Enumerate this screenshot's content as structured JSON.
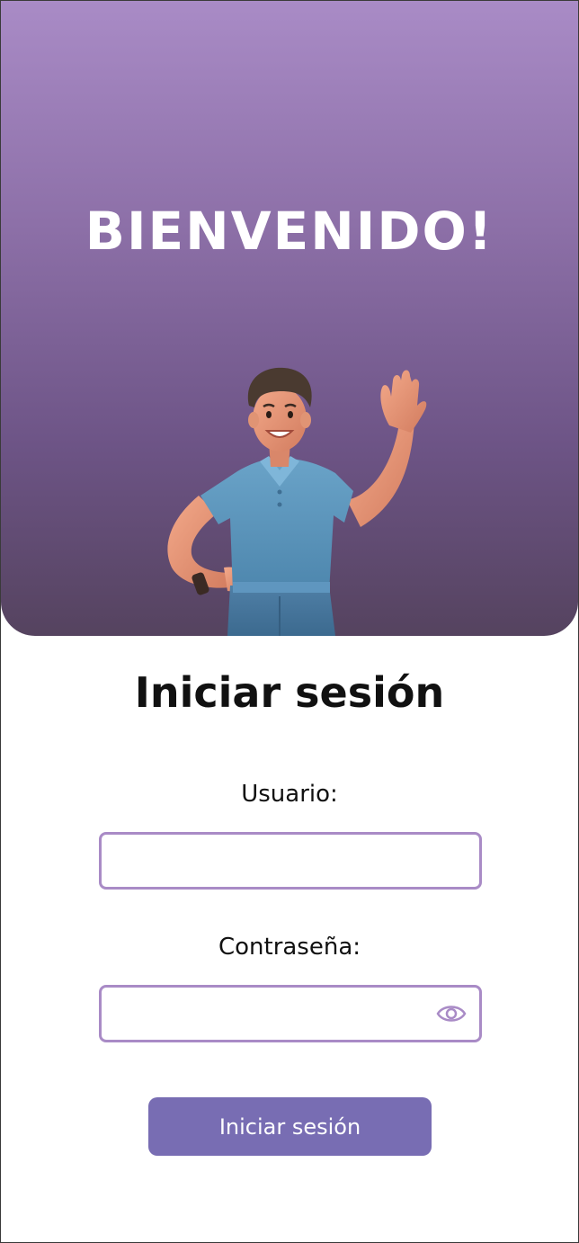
{
  "hero": {
    "title": "BIENVENIDO!"
  },
  "login": {
    "title": "Iniciar sesión",
    "user_label": "Usuario:",
    "user_value": "",
    "password_label": "Contraseña:",
    "password_value": "",
    "submit_label": "Iniciar sesión"
  },
  "icons": {
    "password_toggle": "eye-icon"
  },
  "colors": {
    "accent": "#a98bc6",
    "button": "#786db3",
    "hero_top": "#a98bc6",
    "hero_bottom": "#55435f"
  }
}
